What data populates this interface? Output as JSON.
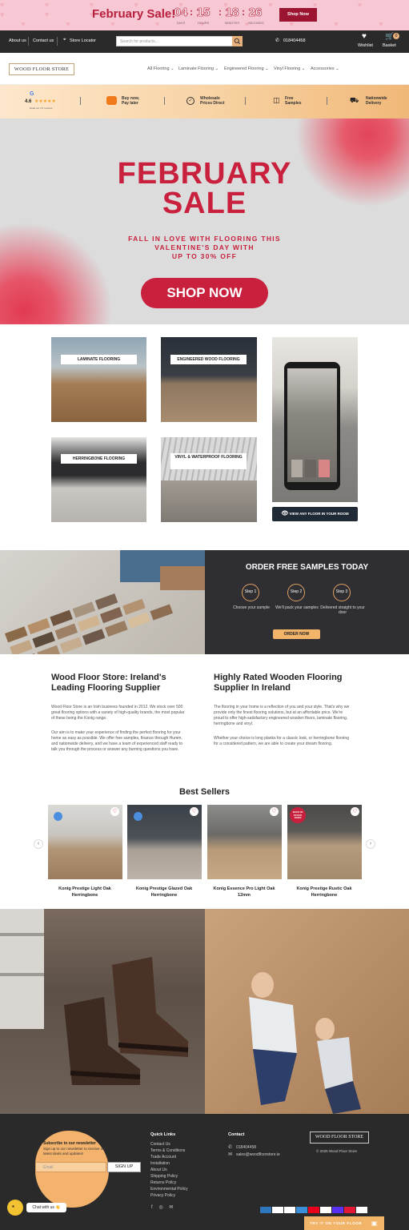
{
  "promo": {
    "title": "February Sale!",
    "countdown": [
      {
        "value": "04",
        "label": "DAYS"
      },
      {
        "value": "15",
        "label": "HOURS"
      },
      {
        "value": "18",
        "label": "MINUTES"
      },
      {
        "value": "26",
        "label": "SECONDS"
      }
    ],
    "button": "Shop Now"
  },
  "topnav": {
    "about": "About us",
    "contact": "Contact us",
    "store": "Store Locator",
    "search_placeholder": "Search for products...",
    "phone": "018404458",
    "wishlist": "Wishlist",
    "basket": "Basket",
    "basket_count": "0"
  },
  "header": {
    "logo": "WOOD FLOOR STORE",
    "menu": [
      "All Flooring",
      "Laminate Flooring",
      "Engineered Flooring",
      "Vinyl Flooring",
      "Accessories"
    ]
  },
  "usp": {
    "rating": "4.6",
    "rating_sub": "Read our 4.6 reviews",
    "items": [
      "Buy now, Pay later",
      "Wholesale Prices Direct",
      "Free Samples",
      "Nationwide Delivery"
    ]
  },
  "hero": {
    "title_line1": "FEBRUARY",
    "title_line2": "SALE",
    "sub_line1": "FALL IN LOVE WITH FLOORING THIS",
    "sub_line2": "VALENTINE'S DAY WITH",
    "sub_line3": "UP TO 30% OFF",
    "button": "SHOP NOW"
  },
  "categories": {
    "laminate": "LAMINATE FLOORING",
    "engineered": "ENGINEERED WOOD FLOORING",
    "herringbone": "HERRINGBONE FLOORING",
    "vinyl": "VINYL & WATERPROOF FLOORING",
    "room_button": "VIEW ANY FLOOR IN YOUR ROOM"
  },
  "samples": {
    "title": "ORDER FREE SAMPLES TODAY",
    "steps": [
      {
        "label": "Step 1",
        "text": "Choose your sample"
      },
      {
        "label": "Step 2",
        "text": "We'll pack your samples"
      },
      {
        "label": "Step 3",
        "text": "Delivered straight to your door"
      }
    ],
    "button": "ORDER NOW"
  },
  "about": {
    "left_title_1": "Wood Floor Store: Ireland's",
    "left_title_2": "Leading Flooring Supplier",
    "left_p1": "Wood Floor Store is an Irish business founded in 2012. We stock over 500 great flooring options with a variety of high-quality brands, the most popular of these being the Konig range.",
    "left_p2": "Our aim is to make your experience of finding the perfect flooring for your home as easy as possible. We offer free samples, finance through Humm, and nationwide delivery, and we have a team of experienced staff ready to talk you through the process or answer any burning questions you have.",
    "right_title_1": "Highly Rated Wooden Flooring",
    "right_title_2": "Supplier In Ireland",
    "right_p1": "The flooring in your home is a reflection of you and your style. That's why we provide only the finest flooring solutions, but at an affordable price. We're proud to offer high-satisfactory engineered wooden floors, laminate flooring, herringbone and vinyl.",
    "right_p2": "Whether your choice is long planks for a classic look, or herringbone flooring for a considered pattern, we are able to create your dream flooring."
  },
  "bestsellers": {
    "title": "Best Sellers",
    "products": [
      {
        "name1": "Konig Prestige Light Oak",
        "name2": "Herringbone"
      },
      {
        "name1": "Konig Prestige Glazed Oak",
        "name2": "Herringbone"
      },
      {
        "name1": "Konig Essence Pro Light Oak",
        "name2": "12mm"
      },
      {
        "name1": "Konig Prestige Rustic Oak",
        "name2": "Herringbone"
      }
    ],
    "badge": "BACK IN STOCK SOON"
  },
  "footer": {
    "newsletter_title": "Subscribe to our newsletter",
    "newsletter_text": "Sign up to our newsletter to receive our latest deals and updates!",
    "email_placeholder": "Email",
    "signup": "SIGN UP",
    "quick_links_title": "Quick Links",
    "quick_links": [
      "Contact Us",
      "Terms & Conditions",
      "Trade Account",
      "Installation",
      "About Us",
      "Shipping Policy",
      "Returns Policy",
      "Environmental Policy",
      "Privacy Policy"
    ],
    "contact_title": "Contact",
    "phone": "018404458",
    "email": "sales@woodfloorstore.ie",
    "logo": "WOOD FLOOR STORE",
    "copyright": "© 2025 Wood Floor Store",
    "chat": "Chat with us 👋",
    "try_btn": "TRY IT ON YOUR FLOOR",
    "payments": [
      "AMEX",
      "Pay",
      "GPay",
      "Maestro",
      "MC",
      "PayPal",
      "ShopPay",
      "UnionPay",
      "VISA"
    ]
  }
}
